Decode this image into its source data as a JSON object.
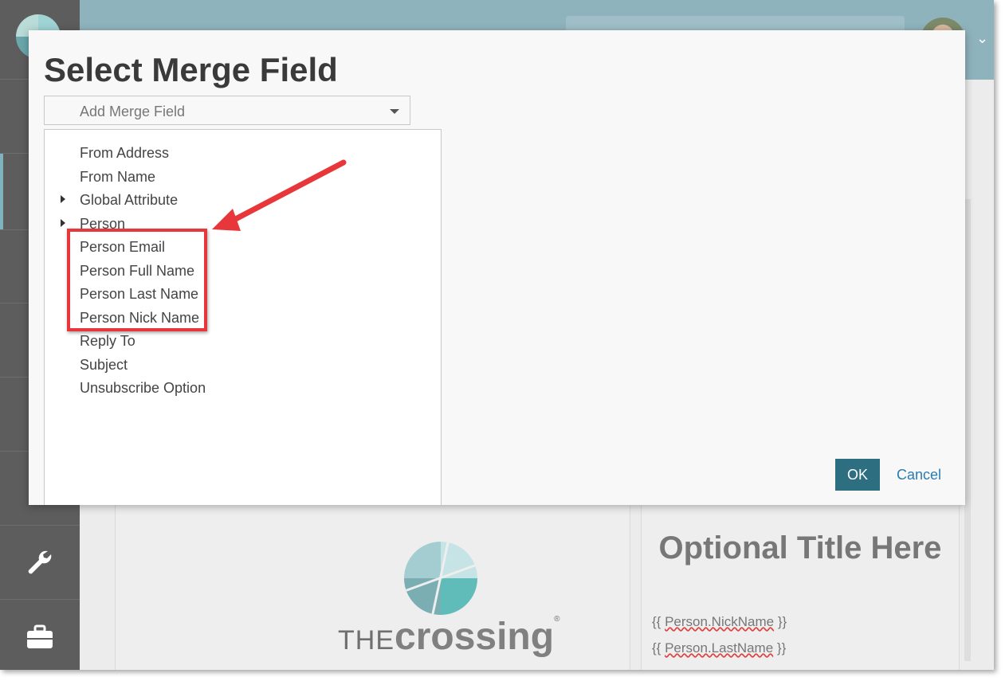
{
  "modal": {
    "title": "Select Merge Field",
    "dropdown_placeholder": "Add Merge Field",
    "ok_label": "OK",
    "cancel_label": "Cancel"
  },
  "menu_items": [
    {
      "label": "From Address",
      "expandable": false
    },
    {
      "label": "From Name",
      "expandable": false
    },
    {
      "label": "Global Attribute",
      "expandable": true
    },
    {
      "label": "Person",
      "expandable": true
    },
    {
      "label": "Person Email",
      "expandable": false
    },
    {
      "label": "Person Full Name",
      "expandable": false
    },
    {
      "label": "Person Last Name",
      "expandable": false
    },
    {
      "label": "Person Nick Name",
      "expandable": false
    },
    {
      "label": "Reply To",
      "expandable": false
    },
    {
      "label": "Subject",
      "expandable": false
    },
    {
      "label": "Unsubscribe Option",
      "expandable": false
    }
  ],
  "preview": {
    "logo_the": "THE",
    "logo_name": "crossing",
    "logo_mark": "®",
    "optional_title": "Optional Title Here",
    "merge_line_1_open": "{{ ",
    "merge_line_1_field": "Person.NickName",
    "merge_line_1_close": " }}",
    "merge_line_2_open": "{{ ",
    "merge_line_2_field": "Person.LastName",
    "merge_line_2_close": " }}"
  },
  "colors": {
    "sidebar": "#5d5d5d",
    "topbar": "#8fb3bd",
    "ok_button": "#2d6f80",
    "annotation": "#e8373a",
    "link": "#2b7bb0"
  },
  "icons": {
    "sidebar": [
      "wrench-icon",
      "briefcase-icon"
    ],
    "header": [
      "user-avatar",
      "chevron-down-icon"
    ]
  }
}
